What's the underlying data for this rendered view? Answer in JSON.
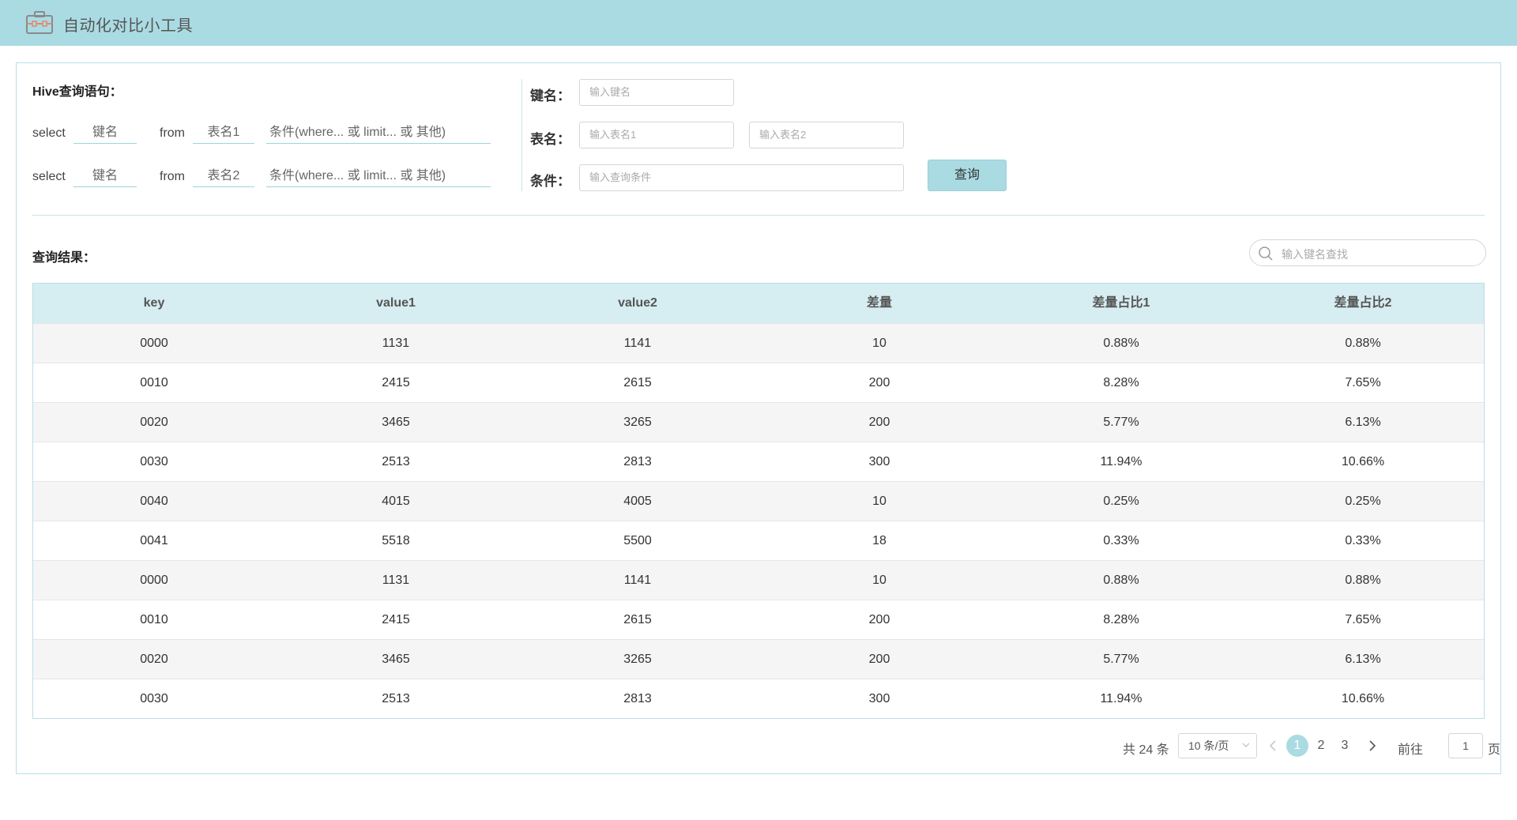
{
  "header": {
    "title": "自动化对比小工具",
    "logo_icon": "toolbox-icon"
  },
  "query_panel": {
    "title": "Hive查询语句：",
    "row1": {
      "select": "select",
      "key_placeholder": "键名",
      "from": "from",
      "table_placeholder": "表名1",
      "cond_placeholder": "条件(where... 或 limit... 或 其他)"
    },
    "row2": {
      "select": "select",
      "key_placeholder": "键名",
      "from": "from",
      "table_placeholder": "表名2",
      "cond_placeholder": "条件(where... 或 limit... 或 其他)"
    }
  },
  "form": {
    "key_label": "键名：",
    "key_placeholder": "输入键名",
    "table_label": "表名：",
    "table1_placeholder": "输入表名1",
    "table2_placeholder": "输入表名2",
    "cond_label": "条件：",
    "cond_placeholder": "输入查询条件",
    "query_button": "查询"
  },
  "results": {
    "title": "查询结果：",
    "search_placeholder": "输入键名查找",
    "columns": [
      "key",
      "value1",
      "value2",
      "差量",
      "差量占比1",
      "差量占比2"
    ],
    "rows": [
      [
        "0000",
        "1131",
        "1141",
        "10",
        "0.88%",
        "0.88%"
      ],
      [
        "0010",
        "2415",
        "2615",
        "200",
        "8.28%",
        "7.65%"
      ],
      [
        "0020",
        "3465",
        "3265",
        "200",
        "5.77%",
        "6.13%"
      ],
      [
        "0030",
        "2513",
        "2813",
        "300",
        "11.94%",
        "10.66%"
      ],
      [
        "0040",
        "4015",
        "4005",
        "10",
        "0.25%",
        "0.25%"
      ],
      [
        "0041",
        "5518",
        "5500",
        "18",
        "0.33%",
        "0.33%"
      ],
      [
        "0000",
        "1131",
        "1141",
        "10",
        "0.88%",
        "0.88%"
      ],
      [
        "0010",
        "2415",
        "2615",
        "200",
        "8.28%",
        "7.65%"
      ],
      [
        "0020",
        "3465",
        "3265",
        "200",
        "5.77%",
        "6.13%"
      ],
      [
        "0030",
        "2513",
        "2813",
        "300",
        "11.94%",
        "10.66%"
      ]
    ]
  },
  "pagination": {
    "total": "共 24 条",
    "page_size": "10 条/页",
    "pages": [
      "1",
      "2",
      "3"
    ],
    "current_page": "1",
    "goto_label": "前往",
    "goto_value": "1",
    "page_suffix": "页"
  },
  "colors": {
    "accent": "#aadbe3",
    "table_header": "#d6edf1",
    "stripe": "#f5f5f5"
  }
}
